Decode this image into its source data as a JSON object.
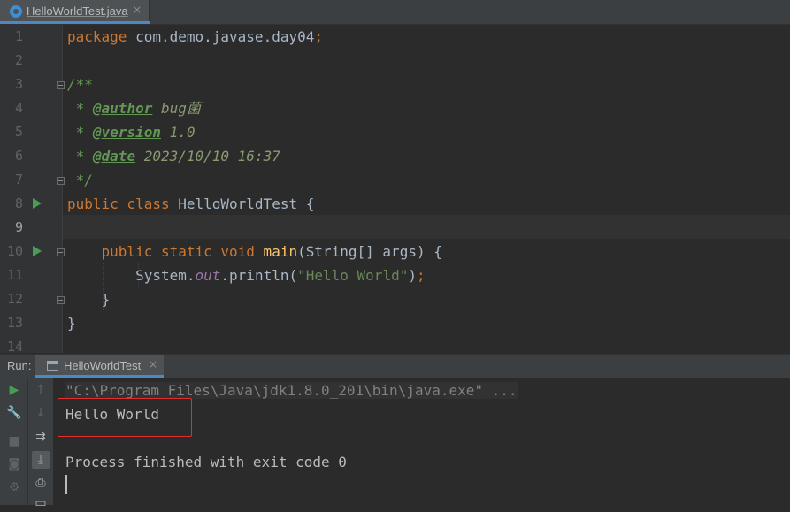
{
  "tab": {
    "filename": "HelloWorldTest.java",
    "close": "×"
  },
  "editor": {
    "line_numbers": [
      "1",
      "2",
      "3",
      "4",
      "5",
      "6",
      "7",
      "8",
      "9",
      "10",
      "11",
      "12",
      "13",
      "14"
    ],
    "code": {
      "l1_kw": "package",
      "l1_pkg": " com.demo.javase.day04",
      "l1_semi": ";",
      "l3": "/**",
      "l4_star": " * ",
      "l4_tag": "@author",
      "l4_val": " bug菌",
      "l5_star": " * ",
      "l5_tag": "@version",
      "l5_val": " 1.0",
      "l6_star": " * ",
      "l6_tag": "@date",
      "l6_val": " 2023/10/10 16:37",
      "l7": " */",
      "l8_kw": "public class",
      "l8_name": " HelloWorldTest {",
      "l10_kw": "    public static void",
      "l10_fn": " main",
      "l10_rest": "(String[] args) {",
      "l11_a": "        System.",
      "l11_field": "out",
      "l11_b": ".println(",
      "l11_str": "\"Hello World\"",
      "l11_c": ")",
      "l11_semi": ";",
      "l12": "    }",
      "l13": "}"
    }
  },
  "run_panel": {
    "label": "Run:",
    "tab_label": "HelloWorldTest",
    "tab_close": "×",
    "output": {
      "command": "\"C:\\Program Files\\Java\\jdk1.8.0_201\\bin\\java.exe\" ...",
      "hello": "Hello World",
      "finished": "Process finished with exit code 0"
    }
  },
  "icons": [
    "java-class-icon",
    "run-gutter-icon",
    "rerun-icon",
    "wrench-icon",
    "stop-icon",
    "camera-icon",
    "settings-icon",
    "up-arrow-icon",
    "down-arrow-icon",
    "soft-wrap-icon",
    "scroll-to-end-icon",
    "print-icon",
    "trash-icon"
  ],
  "colors": {
    "highlight_box": "#e0302e",
    "accent": "#4a88c7",
    "run_green": "#499c54"
  }
}
